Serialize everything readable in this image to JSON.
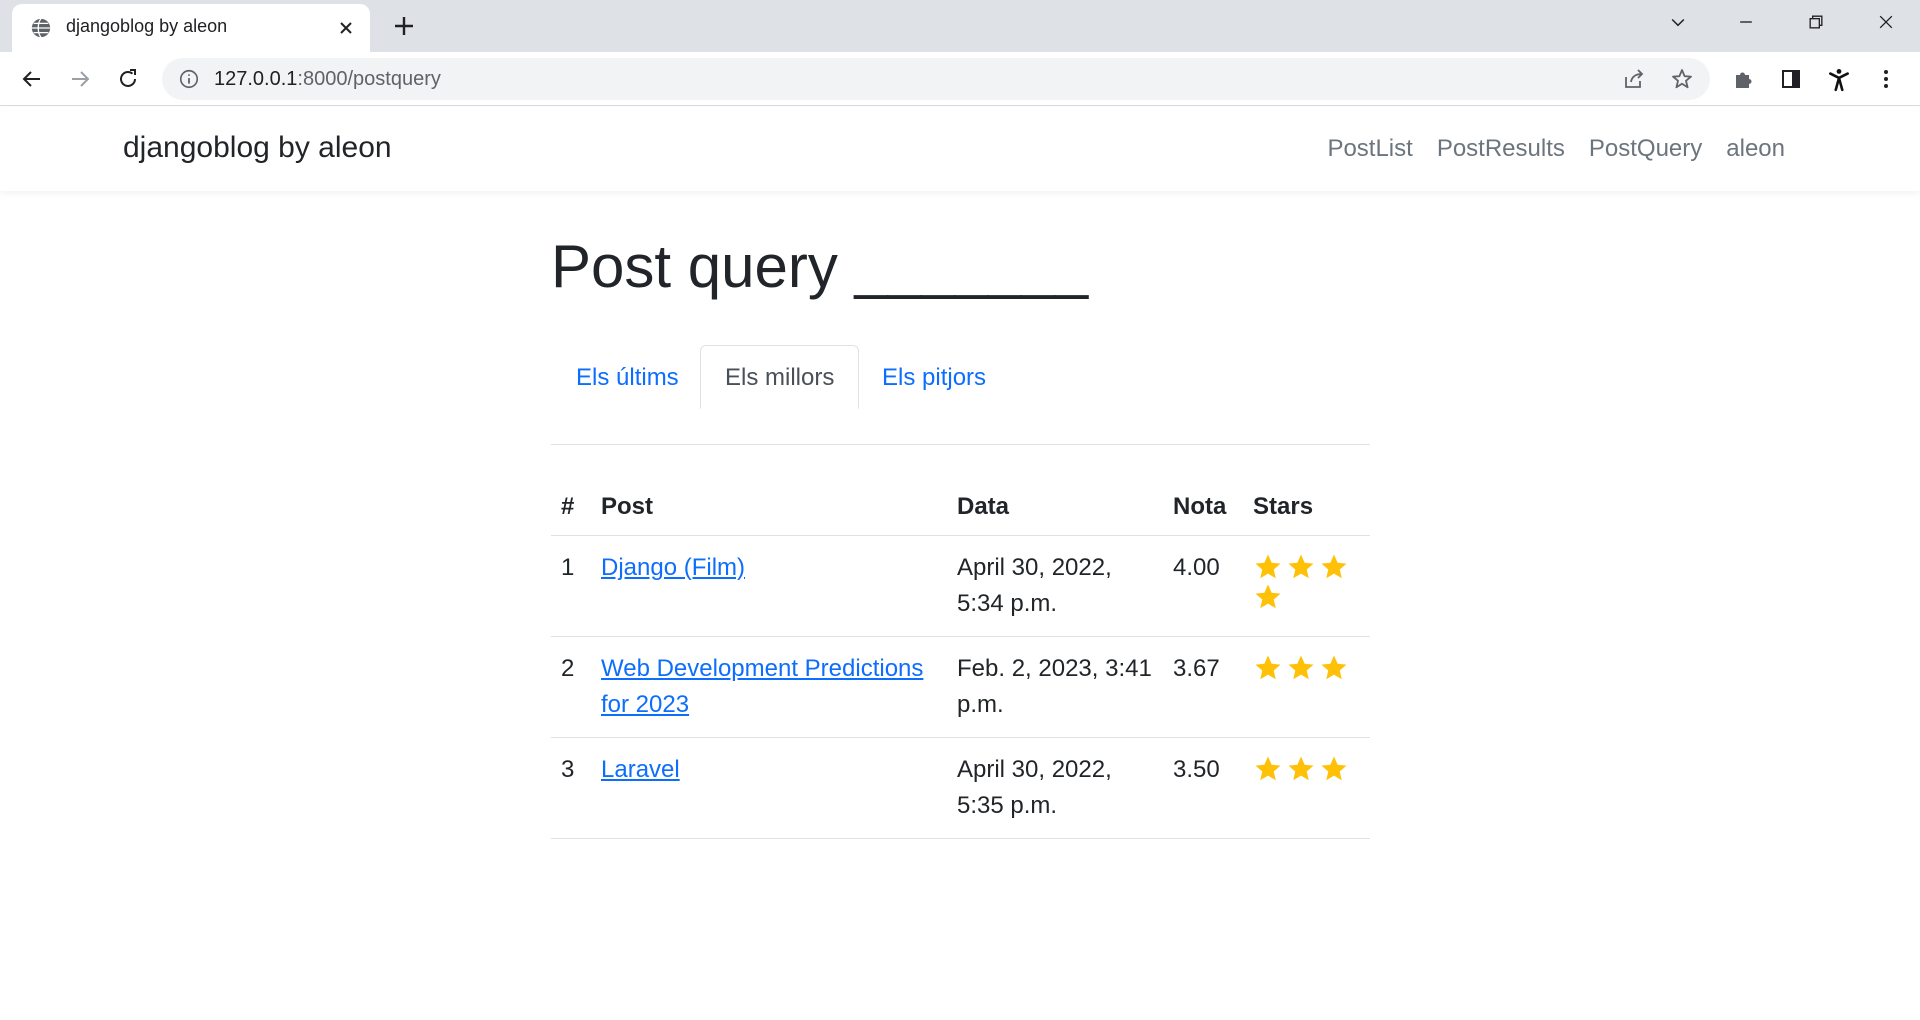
{
  "browser": {
    "tab_title": "djangoblog by aleon",
    "url_host": "127.0.0.1",
    "url_path": ":8000/postquery",
    "icons": [
      "globe-icon",
      "close-icon",
      "plus-icon",
      "chevron-down-icon",
      "minimize-icon",
      "restore-icon",
      "close-window-icon",
      "back-icon",
      "forward-icon",
      "reload-icon",
      "info-icon",
      "share-icon",
      "star-outline-icon",
      "puzzle-icon",
      "sidepanel-icon",
      "profile-icon",
      "menu-dots-icon"
    ]
  },
  "navbar": {
    "brand": "djangoblog by aleon",
    "links": [
      "PostList",
      "PostResults",
      "PostQuery",
      "aleon"
    ]
  },
  "main": {
    "title": "Post query _______",
    "tabs": [
      "Els últims",
      "Els millors",
      "Els pitjors"
    ],
    "active_tab": "Els millors",
    "table": {
      "headers": [
        "#",
        "Post",
        "Data",
        "Nota",
        "Stars"
      ],
      "rows": [
        {
          "num": "1",
          "post": "Django (Film)",
          "date": "April 30, 2022, 5:34 p.m.",
          "nota": "4.00",
          "stars": 4
        },
        {
          "num": "2",
          "post": "Web Development Predictions for 2023",
          "date": "Feb. 2, 2023, 3:41 p.m.",
          "nota": "3.67",
          "stars": 3
        },
        {
          "num": "3",
          "post": "Laravel",
          "date": "April 30, 2022, 5:35 p.m.",
          "nota": "3.50",
          "stars": 3
        }
      ]
    }
  },
  "colors": {
    "link": "#0d6efd",
    "star": "#ffc107",
    "nav_text": "#6c757d",
    "tabstrip": "#dee1e6"
  }
}
